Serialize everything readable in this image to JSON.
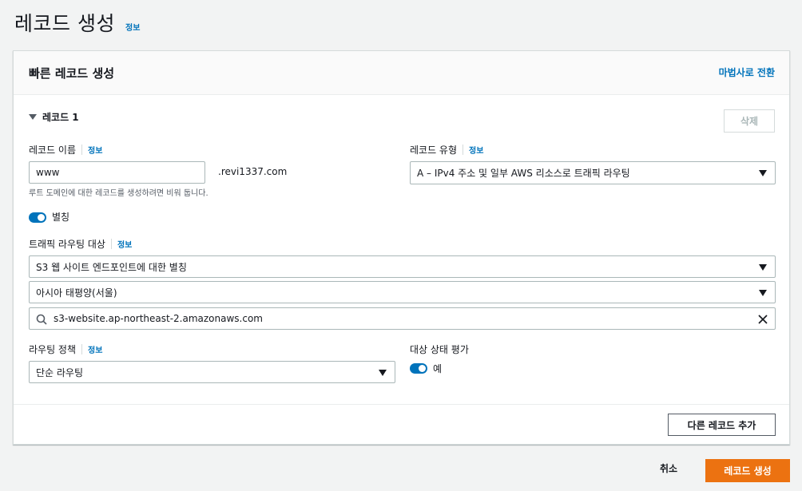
{
  "page": {
    "title": "레코드 생성",
    "info": "정보"
  },
  "card": {
    "title": "빠른 레코드 생성",
    "wizard_link": "마법사로 전환"
  },
  "record": {
    "heading": "레코드 1",
    "delete_label": "삭제",
    "name": {
      "label": "레코드 이름",
      "info": "정보",
      "value": "www",
      "suffix": ".revi1337.com",
      "hint": "루트 도메인에 대한 레코드를 생성하려면 비워 둡니다."
    },
    "type": {
      "label": "레코드 유형",
      "info": "정보",
      "value": "A – IPv4 주소 및 일부 AWS 리소스로 트래픽 라우팅"
    },
    "alias": {
      "label": "별칭",
      "enabled": true
    },
    "target": {
      "label": "트래픽 라우팅 대상",
      "info": "정보",
      "endpoint": "S3 웹 사이트 엔드포인트에 대한 별칭",
      "region": "아시아 태평양(서울)",
      "search_value": "s3-website.ap-northeast-2.amazonaws.com"
    },
    "routing_policy": {
      "label": "라우팅 정책",
      "info": "정보",
      "value": "단순 라우팅"
    },
    "health": {
      "label": "대상 상태 평가",
      "toggle_label": "예",
      "enabled": true
    }
  },
  "footer": {
    "add_record_label": "다른 레코드 추가",
    "cancel_label": "취소",
    "create_label": "레코드 생성"
  },
  "colors": {
    "accent": "#0073bb",
    "primary_button": "#ec7211"
  }
}
